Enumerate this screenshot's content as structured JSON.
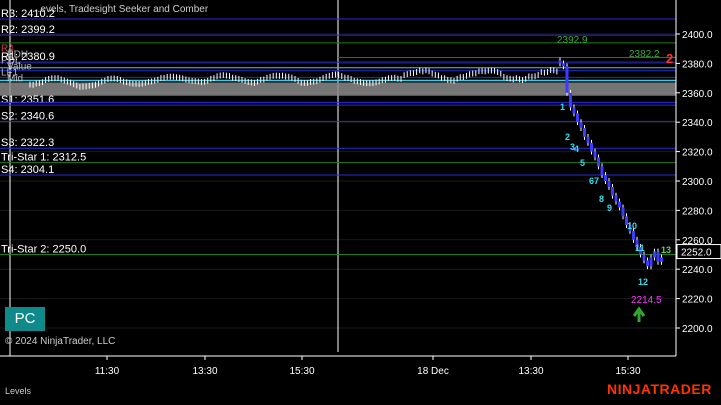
{
  "window": {
    "title": "...evels, Tradesight Seeker and Comber",
    "watermark": "© 2024 NinjaTrader, LLC",
    "brand": "NINJATRADER",
    "pane_label": "Levels",
    "pc_button_label": "PC"
  },
  "colors": {
    "background": "#000000",
    "blue_line": "#2a2ad6",
    "green_line": "#1f7a1f",
    "red_line": "#cc2222",
    "cyan_line": "#40c8e8",
    "zone_fill": "#8a8a8a",
    "candle": "#ffffff",
    "down_candle": "#3b3bff",
    "magenta": "#ff33ff",
    "brand_red": "#ff3300"
  },
  "chart_data": {
    "type": "candlestick",
    "y_axis": {
      "ticks": [
        "2400.0",
        "2380.0",
        "2360.0",
        "2340.0",
        "2320.0",
        "2300.0",
        "2280.0",
        "2260.0",
        "2240.0",
        "2220.0",
        "2200.0"
      ],
      "current_price": "2252.0"
    },
    "x_axis": {
      "ticks": [
        "11:30",
        "13:30",
        "15:30",
        "18 Dec",
        "13:30",
        "15:30"
      ]
    },
    "levels": [
      {
        "label": "R3: 2410.2",
        "price": 2410.2,
        "color": "blue"
      },
      {
        "label": "R2: 2399.2",
        "price": 2399.2,
        "color": "blue"
      },
      {
        "label": "R1: 2380.9",
        "price": 2380.9,
        "color": "blue"
      },
      {
        "label": "S1: 2351.6",
        "price": 2351.6,
        "color": "blue"
      },
      {
        "label": "S2: 2340.6",
        "price": 2340.6,
        "color": "blue"
      },
      {
        "label": "S3: 2322.3",
        "price": 2322.3,
        "color": "blue"
      },
      {
        "label": "Tri-Star 1: 2312.5",
        "price": 2312.5,
        "color": "green"
      },
      {
        "label": "S4: 2304.1",
        "price": 2304.1,
        "color": "blue"
      },
      {
        "label": "Tri-Star 2: 2250.0",
        "price": 2250.0,
        "color": "green"
      }
    ],
    "overlapping_labels": [
      "R4",
      "PDH",
      "PDL",
      "Value",
      "LF1",
      "Mid"
    ],
    "zone": {
      "top": 2367.0,
      "bottom": 2358.0
    },
    "annotations": [
      {
        "text": "2392.9",
        "color": "green"
      },
      {
        "text": "2382.2",
        "color": "green"
      },
      {
        "text": "2",
        "color": "red"
      },
      {
        "text": "2214.5",
        "color": "magenta"
      }
    ],
    "seeker_counts": [
      "1",
      "2",
      "3",
      "4",
      "5",
      "6",
      "7",
      "8",
      "9",
      "10",
      "11",
      "12",
      "13"
    ]
  }
}
